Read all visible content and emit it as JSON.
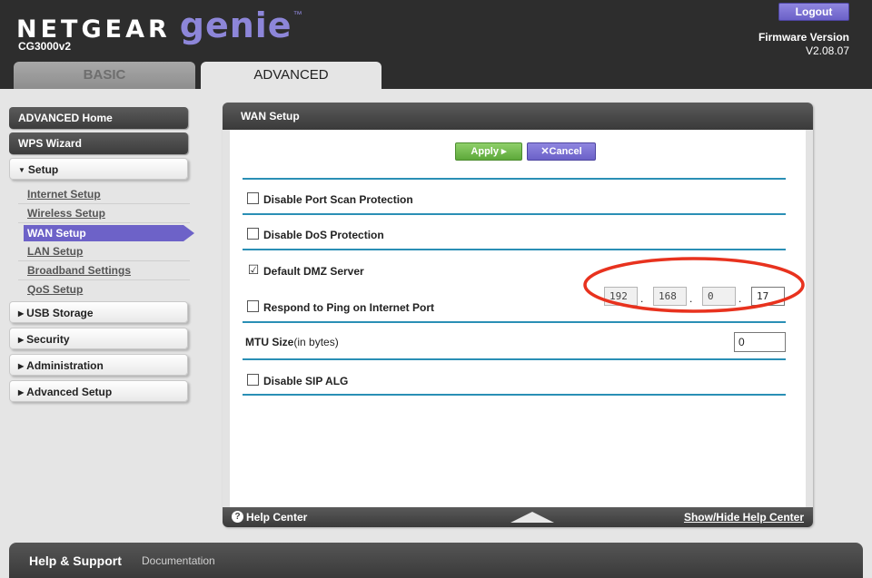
{
  "brand": {
    "name": "NETGEAR",
    "product": "genie",
    "tm": "™",
    "model": "CG3000v2"
  },
  "header": {
    "logout_label": "Logout",
    "firmware_label": "Firmware Version",
    "firmware_value": "V2.08.07"
  },
  "tabs": [
    {
      "label": "BASIC",
      "active": false
    },
    {
      "label": "ADVANCED",
      "active": true
    }
  ],
  "sidebar": {
    "top_items": [
      {
        "label": "ADVANCED Home"
      },
      {
        "label": "WPS Wizard"
      }
    ],
    "setup": {
      "label": "Setup",
      "arrow": "▼"
    },
    "setup_items": [
      {
        "label": "Internet Setup"
      },
      {
        "label": "Wireless Setup"
      },
      {
        "label": "WAN Setup",
        "active": true
      },
      {
        "label": "LAN Setup"
      },
      {
        "label": "Broadband Settings"
      },
      {
        "label": "QoS Setup"
      }
    ],
    "sections": [
      {
        "label": "USB Storage",
        "arrow": "▶"
      },
      {
        "label": "Security",
        "arrow": "▶"
      },
      {
        "label": "Administration",
        "arrow": "▶"
      },
      {
        "label": "Advanced Setup",
        "arrow": "▶"
      }
    ]
  },
  "panel": {
    "title": "WAN Setup",
    "apply_label": "Apply ▸",
    "cancel_label": "✕Cancel",
    "options": {
      "port_scan": {
        "label": "Disable Port Scan Protection",
        "checked": false
      },
      "dos": {
        "label": "Disable DoS Protection",
        "checked": false
      },
      "dmz": {
        "label": "Default DMZ Server",
        "checked": true,
        "ip": [
          "192",
          "168",
          "0",
          "17"
        ]
      },
      "ping": {
        "label": "Respond to Ping on Internet Port",
        "checked": false
      },
      "mtu": {
        "label": "MTU Size",
        "unit": "(in bytes)",
        "value": "0"
      },
      "sip": {
        "label": "Disable SIP ALG",
        "checked": false
      }
    },
    "check_glyph": "☑",
    "dot": "."
  },
  "help": {
    "icon": "?",
    "label": "Help Center",
    "toggle_label": "Show/Hide Help Center"
  },
  "footer": {
    "title": "Help & Support",
    "link": "Documentation"
  },
  "colors": {
    "accent": "#6d62c8",
    "apply": "#6cb548",
    "rule": "#2a8fb5",
    "highlight_ring": "#e8321e"
  }
}
